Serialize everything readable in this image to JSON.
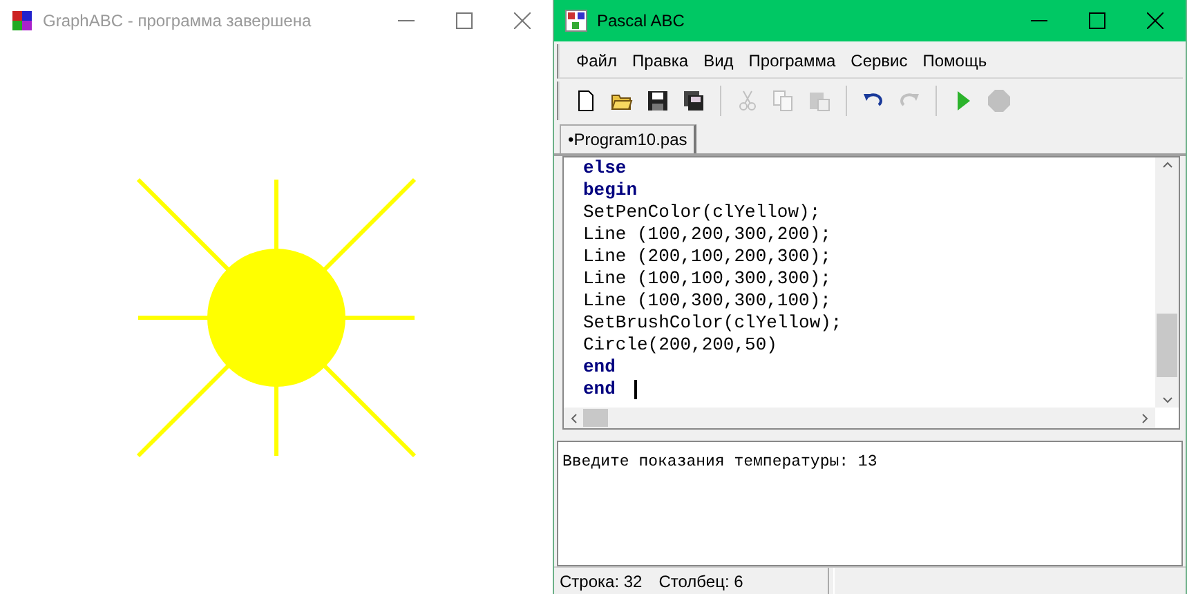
{
  "graph_window": {
    "title": "GraphABC - программа завершена",
    "active": false
  },
  "ide_window": {
    "title": "Pascal ABC",
    "active": true
  },
  "menu": [
    "Файл",
    "Правка",
    "Вид",
    "Программа",
    "Сервис",
    "Помощь"
  ],
  "toolbar": [
    {
      "kind": "new",
      "disabled": false
    },
    {
      "kind": "open",
      "disabled": false
    },
    {
      "kind": "save",
      "disabled": false
    },
    {
      "kind": "saveall",
      "disabled": false
    },
    {
      "kind": "sep"
    },
    {
      "kind": "cut",
      "disabled": true
    },
    {
      "kind": "copy",
      "disabled": true
    },
    {
      "kind": "paste",
      "disabled": true
    },
    {
      "kind": "sep"
    },
    {
      "kind": "undo",
      "disabled": false
    },
    {
      "kind": "redo",
      "disabled": true
    },
    {
      "kind": "sep"
    },
    {
      "kind": "run",
      "disabled": false
    },
    {
      "kind": "stop",
      "disabled": true
    }
  ],
  "tabs": [
    {
      "label": "•Program10.pas",
      "selected": true
    }
  ],
  "code_lines": [
    {
      "kind": "keyword",
      "text": "else"
    },
    {
      "kind": "keyword",
      "text": "begin"
    },
    {
      "kind": "code",
      "text": "SetPenColor(clYellow);"
    },
    {
      "kind": "code",
      "text": "Line (100,200,300,200);"
    },
    {
      "kind": "code",
      "text": "Line (200,100,200,300);"
    },
    {
      "kind": "code",
      "text": "Line (100,100,300,300);"
    },
    {
      "kind": "code",
      "text": "Line (100,300,300,100);"
    },
    {
      "kind": "code",
      "text": "SetBrushColor(clYellow);"
    },
    {
      "kind": "code",
      "text": "Circle(200,200,50)"
    },
    {
      "kind": "keyword",
      "text": "end"
    },
    {
      "kind": "keyword",
      "text": "end",
      "caret": true
    }
  ],
  "output": "Введите показания температуры: 13",
  "status_bar": [
    "Строка: 32",
    "Столбец: 6"
  ]
}
